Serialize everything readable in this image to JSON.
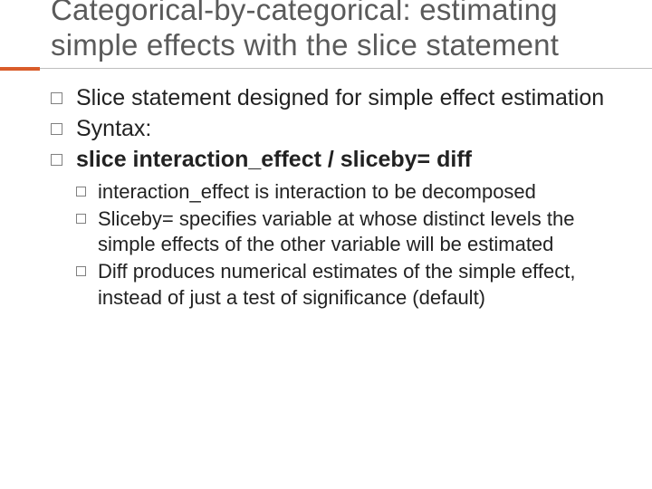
{
  "title": "Categorical-by-categorical: estimating simple effects with the slice statement",
  "bullets": {
    "b1": "Slice statement designed for simple effect estimation",
    "b2": "Syntax:",
    "b3": "slice interaction_effect / sliceby=   diff",
    "sub1_lead": "interaction_effect",
    "sub1_rest": " is interaction to be decomposed",
    "sub2_lead": "Sliceby=",
    "sub2_rest": " specifies variable at whose distinct levels the simple effects of the other variable will be estimated",
    "sub3_lead": "Diff",
    "sub3_rest": " produces numerical estimates of the simple effect, instead of just a test of significance (default)"
  }
}
